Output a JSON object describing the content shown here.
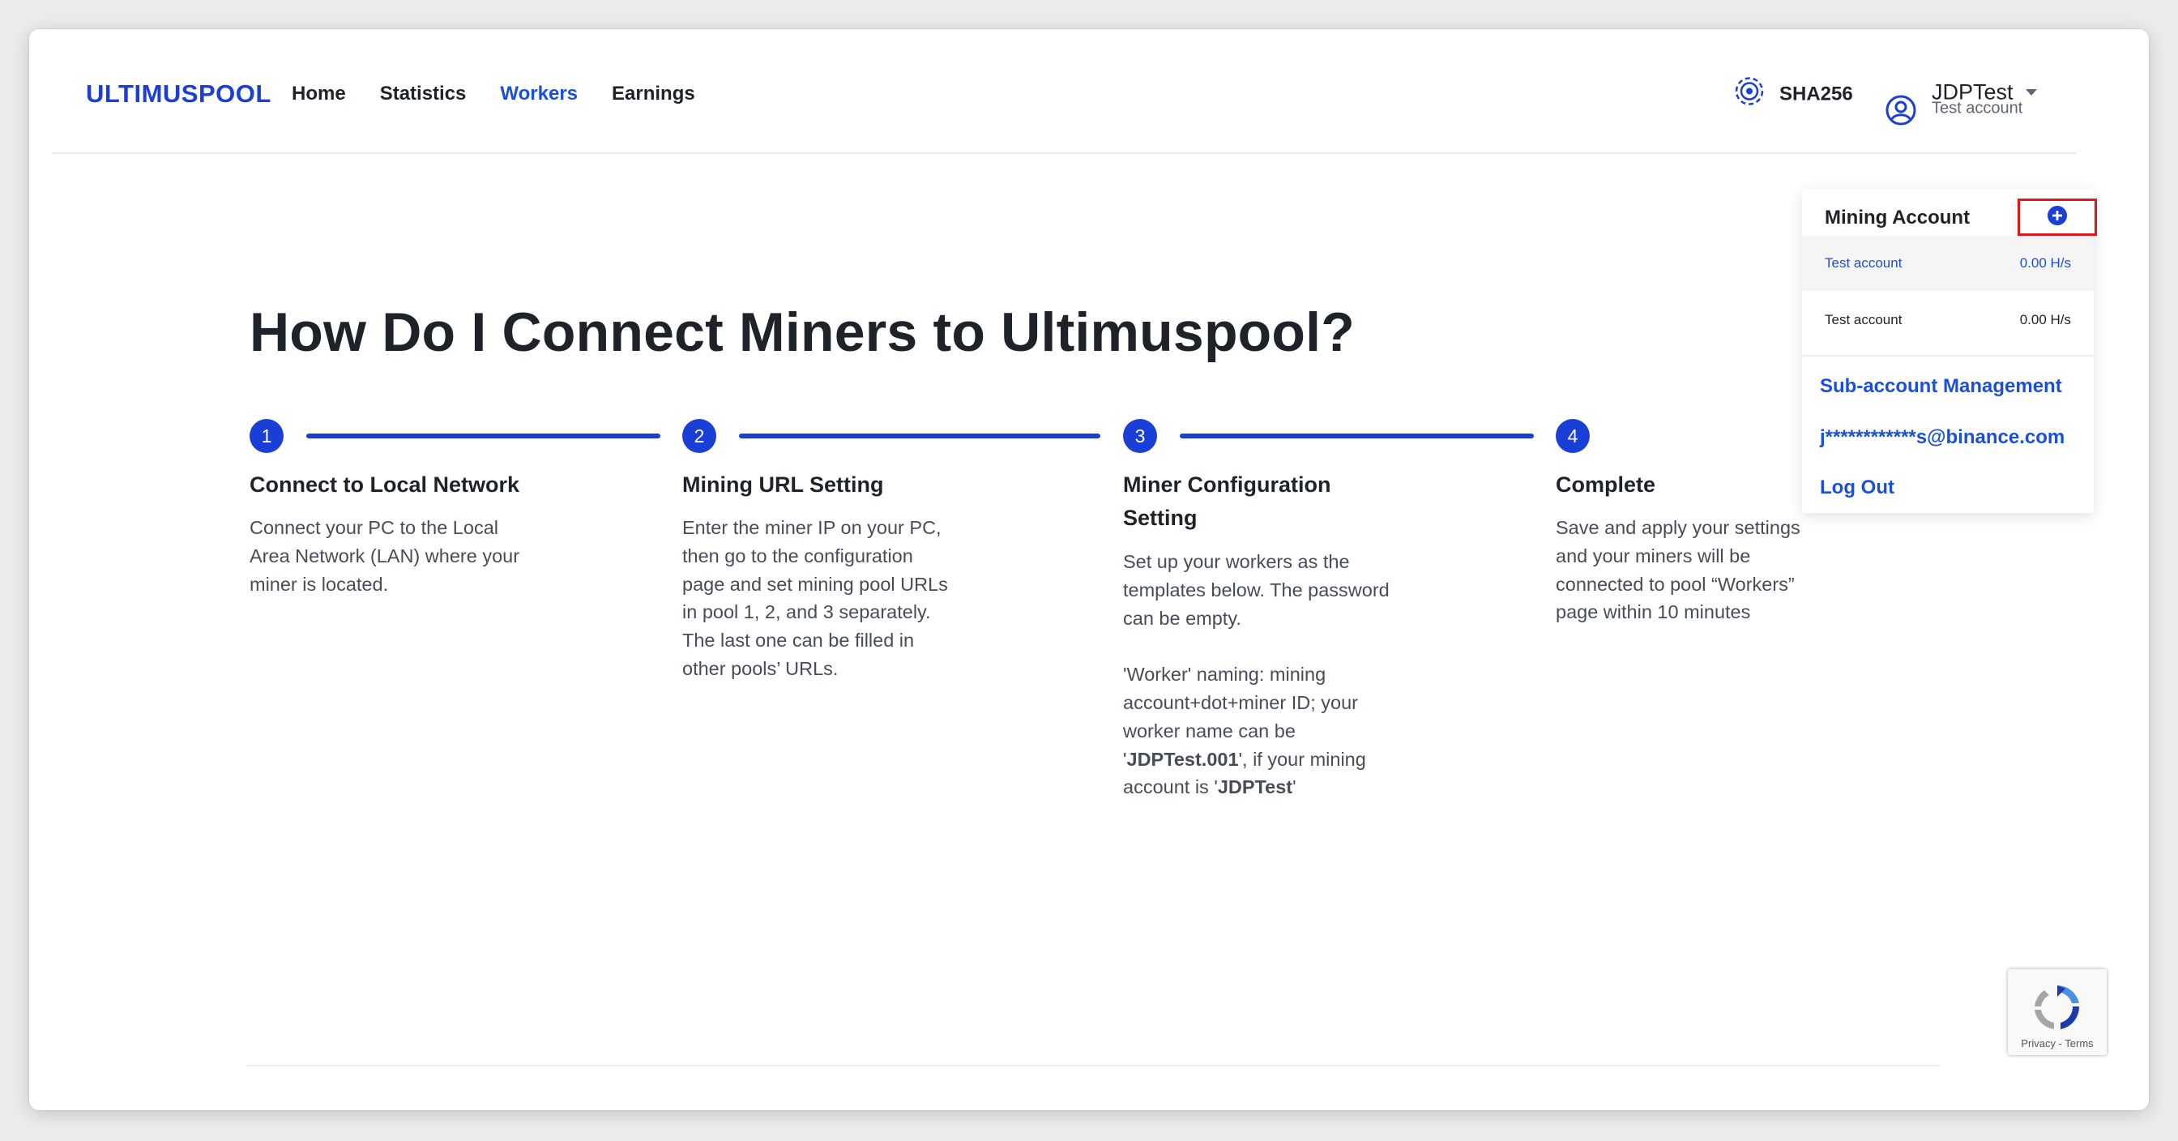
{
  "header": {
    "logo": "ULTIMUSPOOL",
    "nav": [
      {
        "label": "Home"
      },
      {
        "label": "Statistics"
      },
      {
        "label": "Workers"
      },
      {
        "label": "Earnings"
      }
    ],
    "active_nav": "Workers",
    "algorithm": "SHA256",
    "user": {
      "name": "JDPTest",
      "sub_account": "Test account"
    }
  },
  "main": {
    "title": "How Do I Connect Miners to Ultimuspool?",
    "steps": [
      {
        "number": "1",
        "title": "Connect to Local Network",
        "description": "Connect your PC to the Local\nArea Network (LAN) where your\nminer is located."
      },
      {
        "number": "2",
        "title": "Mining URL Setting",
        "description": "Enter the miner IP on your PC,\nthen go to the configuration\npage and set mining pool URLs\nin pool 1, 2, and 3 separately.\nThe last one can be filled in\nother pools’ URLs."
      },
      {
        "number": "3",
        "title": "Miner Configuration Setting",
        "description_1": "Set up your workers as the\ntemplates below. The password\ncan be empty.",
        "description_2a": "'Worker' naming: mining\naccount+dot+miner ID; your\nworker name can be\n'",
        "description_2b": "JDPTest.001",
        "description_2c": "', if your mining\naccount is '",
        "description_2d": "JDPTest",
        "description_2e": "'"
      },
      {
        "number": "4",
        "title": "Complete",
        "description": "Save and apply your settings\nand your miners will be\nconnected to pool “Workers”\npage within 10 minutes"
      }
    ]
  },
  "dropdown": {
    "title": "Mining Account",
    "accounts": [
      {
        "name": "Test account",
        "hashrate": "0.00 H/s",
        "selected": true
      },
      {
        "name": "Test account",
        "hashrate": "0.00 H/s",
        "selected": false
      }
    ],
    "links": {
      "sub_account_management": "Sub-account Management",
      "email": "j************s@binance.com",
      "logout": "Log Out"
    }
  },
  "recaptcha": {
    "links": "Privacy - Terms"
  },
  "colors": {
    "brand": "#1a3fd6",
    "link": "#1a50d8",
    "highlight_box": "#e0161b"
  }
}
